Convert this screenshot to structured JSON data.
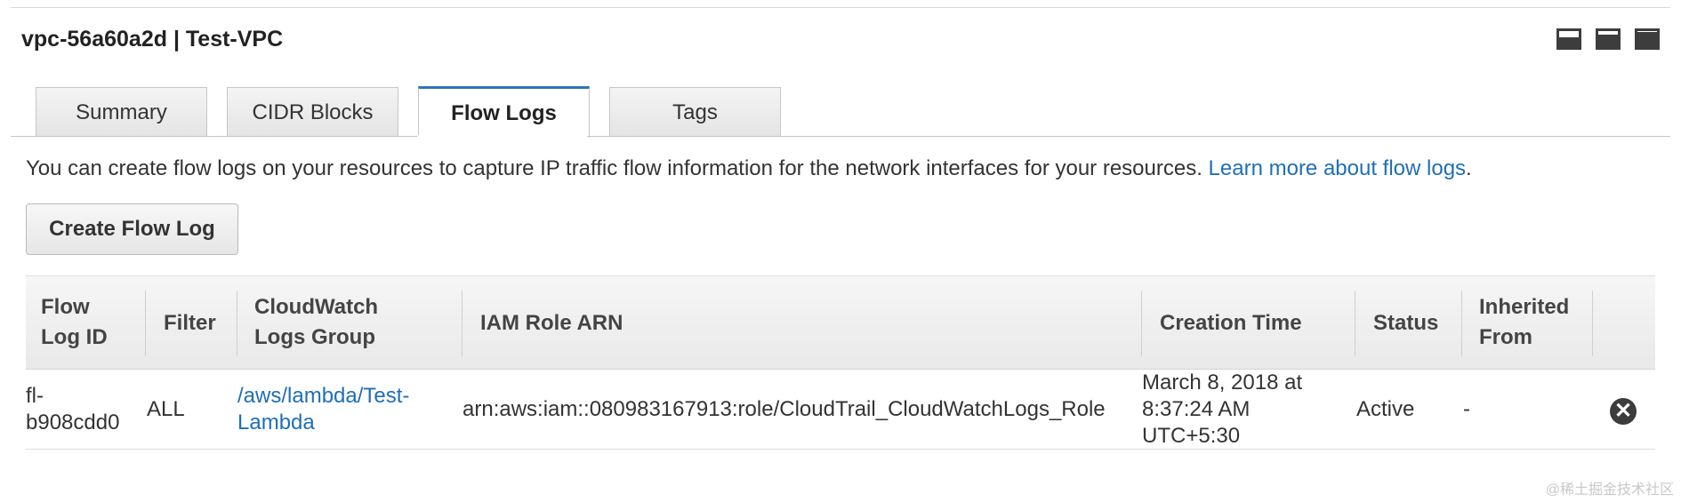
{
  "panel": {
    "title": "vpc-56a60a2d | Test-VPC"
  },
  "view_controls": [
    {
      "icon": "panel-bottom-small-icon"
    },
    {
      "icon": "panel-bottom-half-icon"
    },
    {
      "icon": "panel-maximize-icon"
    }
  ],
  "tabs": [
    {
      "label": "Summary",
      "active": false
    },
    {
      "label": "CIDR Blocks",
      "active": false
    },
    {
      "label": "Flow Logs",
      "active": true
    },
    {
      "label": "Tags",
      "active": false
    }
  ],
  "info": {
    "text": "You can create flow logs on your resources to capture IP traffic flow information for the network interfaces for your resources. ",
    "link": "Learn more about flow logs",
    "suffix": "."
  },
  "actions": {
    "create_label": "Create Flow Log"
  },
  "table": {
    "headers": {
      "flow_log_id": [
        "Flow",
        "Log ID"
      ],
      "filter": "Filter",
      "cloudwatch": [
        "CloudWatch",
        "Logs Group"
      ],
      "iam_role": "IAM Role ARN",
      "creation_time": "Creation Time",
      "status": "Status",
      "inherited": [
        "Inherited",
        "From"
      ]
    },
    "rows": [
      {
        "flow_log_id": [
          "fl-",
          "b908cdd0"
        ],
        "filter": "ALL",
        "cloudwatch": [
          "/aws/lambda/Test-",
          "Lambda"
        ],
        "iam_role": "arn:aws:iam::080983167913:role/CloudTrail_CloudWatchLogs_Role",
        "creation_time": [
          "March 8, 2018 at",
          "8:37:24 AM",
          "UTC+5:30"
        ],
        "status": "Active",
        "inherited": "-",
        "delete_icon": "close-circle-icon",
        "delete_symbol": "✕"
      }
    ]
  },
  "watermark": "@稀土掘金技术社区",
  "colors": {
    "accent": "#2e73b8",
    "link": "#1f6fb6",
    "header_bg": "#ececec"
  }
}
